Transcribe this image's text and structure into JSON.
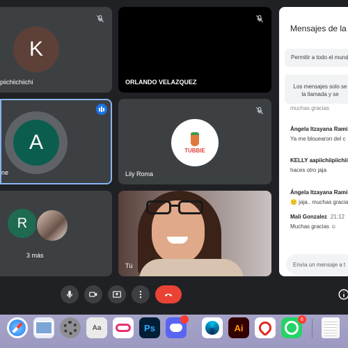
{
  "participants": [
    {
      "initial": "K",
      "name": "piichiichiichi"
    },
    {
      "name": "ORLANDO VELAZQUEZ"
    },
    {
      "initial": "A",
      "name": "ne"
    },
    {
      "name": "Lily Roma",
      "logo_text": "TUBBIE"
    },
    {
      "initial": "R",
      "more_label": "3 más"
    },
    {
      "name": "Tú"
    }
  ],
  "chat": {
    "title": "Mensajes de la l",
    "allow_all": "Permitir a todo el mund",
    "notice_line1": "Los mensajes solo se",
    "notice_line2": "la llamada y se",
    "cut_text": "muchas gracias",
    "messages": [
      {
        "sender": "Ángela Itzayana Ramir",
        "time": "",
        "text": "Ya me blouearon del c"
      },
      {
        "sender": "KELLY aapiichiipiichii",
        "time": "",
        "text": "haces otro jaja"
      },
      {
        "sender": "Ángela Itzayana Ramir",
        "time": "",
        "text": "🙂 jaja.. muchas gracia"
      },
      {
        "sender": "Mali Gonzalez",
        "time": "21:12",
        "text": "Muchas gracias ☺"
      }
    ],
    "input_placeholder": "Envía un mensaje a t"
  },
  "colors": {
    "background": "#202124",
    "tile": "#3c4043",
    "end_call": "#ea4335",
    "avatar_k": "#5d4037",
    "avatar_a": "#0b5e4e",
    "avatar_r": "#1e6b52",
    "speaking": "#8ab4f8"
  },
  "icons": [
    "mic-icon",
    "camera-icon",
    "present-icon",
    "more-icon",
    "end-call-icon",
    "info-icon"
  ],
  "dock": {
    "items": [
      "safari",
      "preview",
      "system-preferences",
      "font-book",
      "creative-cloud",
      "photoshop",
      "discord",
      "webex",
      "illustrator",
      "acrobat",
      "whatsapp",
      "document"
    ],
    "badges": {
      "discord": "",
      "whatsapp": "6"
    },
    "ps_label": "Ps",
    "ai_label": "Ai"
  }
}
